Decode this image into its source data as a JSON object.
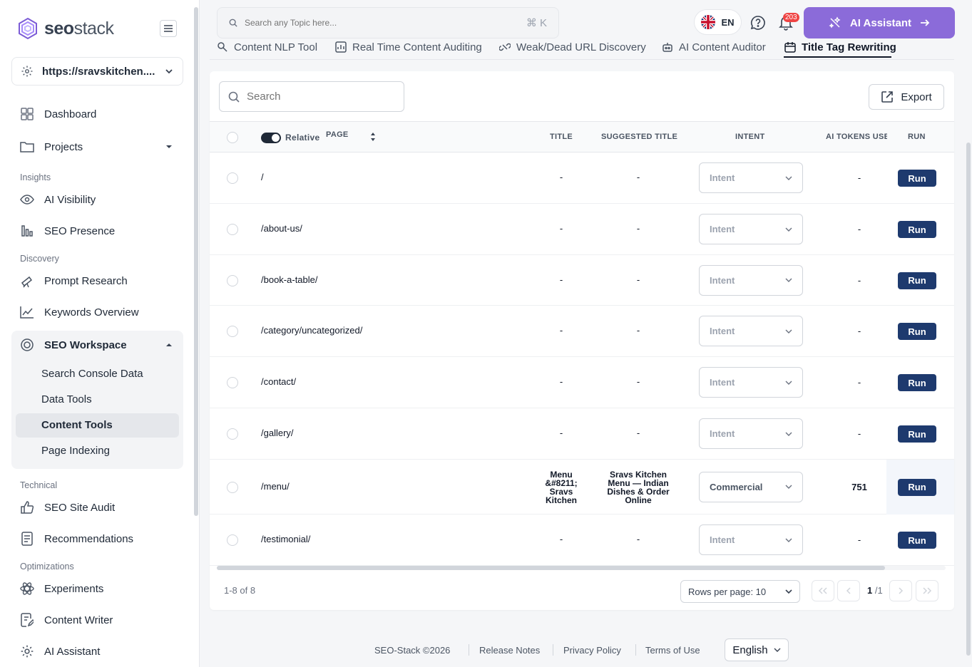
{
  "brand": {
    "name_bold": "seo",
    "name_light": "stack"
  },
  "site_selector": {
    "value": "https://sravskitchen...."
  },
  "nav": {
    "dashboard": "Dashboard",
    "projects": "Projects",
    "section_insights": "Insights",
    "ai_visibility": "AI Visibility",
    "seo_presence": "SEO Presence",
    "section_discovery": "Discovery",
    "prompt_research": "Prompt Research",
    "keywords_overview": "Keywords Overview",
    "seo_workspace": "SEO Workspace",
    "search_console": "Search Console Data",
    "data_tools": "Data Tools",
    "content_tools": "Content Tools",
    "page_indexing": "Page Indexing",
    "section_technical": "Technical",
    "site_audit": "SEO Site Audit",
    "recommendations": "Recommendations",
    "section_optimizations": "Optimizations",
    "experiments": "Experiments",
    "content_writer": "Content Writer",
    "ai_assistant": "AI Assistant"
  },
  "topbar": {
    "search_placeholder": "Search any Topic here...",
    "shortcut": "⌘ K",
    "language": "EN",
    "notification_count": "203",
    "ai_button": "AI Assistant"
  },
  "tabs": [
    {
      "label": "Content NLP Tool"
    },
    {
      "label": "Real Time Content Auditing"
    },
    {
      "label": "Weak/Dead URL Discovery"
    },
    {
      "label": "AI Content Auditor"
    },
    {
      "label": "Title Tag Rewriting"
    }
  ],
  "table": {
    "search_placeholder": "Search",
    "export_label": "Export",
    "relative_label": "Relative",
    "columns": {
      "page": "PAGE",
      "title": "TITLE",
      "suggested": "SUGGESTED TITLE",
      "intent": "INTENT",
      "tokens": "AI TOKENS USE",
      "run": "RUN"
    },
    "rows": [
      {
        "page": "/",
        "title": "-",
        "suggested": "-",
        "intent": "Intent",
        "tokens": "-",
        "run": "Run"
      },
      {
        "page": "/about-us/",
        "title": "-",
        "suggested": "-",
        "intent": "Intent",
        "tokens": "-",
        "run": "Run"
      },
      {
        "page": "/book-a-table/",
        "title": "-",
        "suggested": "-",
        "intent": "Intent",
        "tokens": "-",
        "run": "Run"
      },
      {
        "page": "/category/uncategorized/",
        "title": "-",
        "suggested": "-",
        "intent": "Intent",
        "tokens": "-",
        "run": "Run"
      },
      {
        "page": "/contact/",
        "title": "-",
        "suggested": "-",
        "intent": "Intent",
        "tokens": "-",
        "run": "Run"
      },
      {
        "page": "/gallery/",
        "title": "-",
        "suggested": "-",
        "intent": "Intent",
        "tokens": "-",
        "run": "Run"
      },
      {
        "page": "/menu/",
        "title": "Menu &#8211; Sravs Kitchen",
        "suggested": "Sravs Kitchen Menu — Indian Dishes & Order Online",
        "intent": "Commercial",
        "tokens": "751",
        "run": "Run"
      },
      {
        "page": "/testimonial/",
        "title": "-",
        "suggested": "-",
        "intent": "Intent",
        "tokens": "-",
        "run": "Run"
      }
    ],
    "range": "1-8 of 8",
    "rows_per_page": "Rows per page: 10",
    "current_page": "1",
    "total_pages": "/1"
  },
  "footer": {
    "copyright": "SEO-Stack ©2026",
    "release_notes": "Release Notes",
    "privacy": "Privacy Policy",
    "terms": "Terms of Use",
    "language": "English"
  },
  "colors": {
    "accent": "#8b6bd9",
    "run_button": "#1e3a6e",
    "badge": "#ef4444"
  }
}
